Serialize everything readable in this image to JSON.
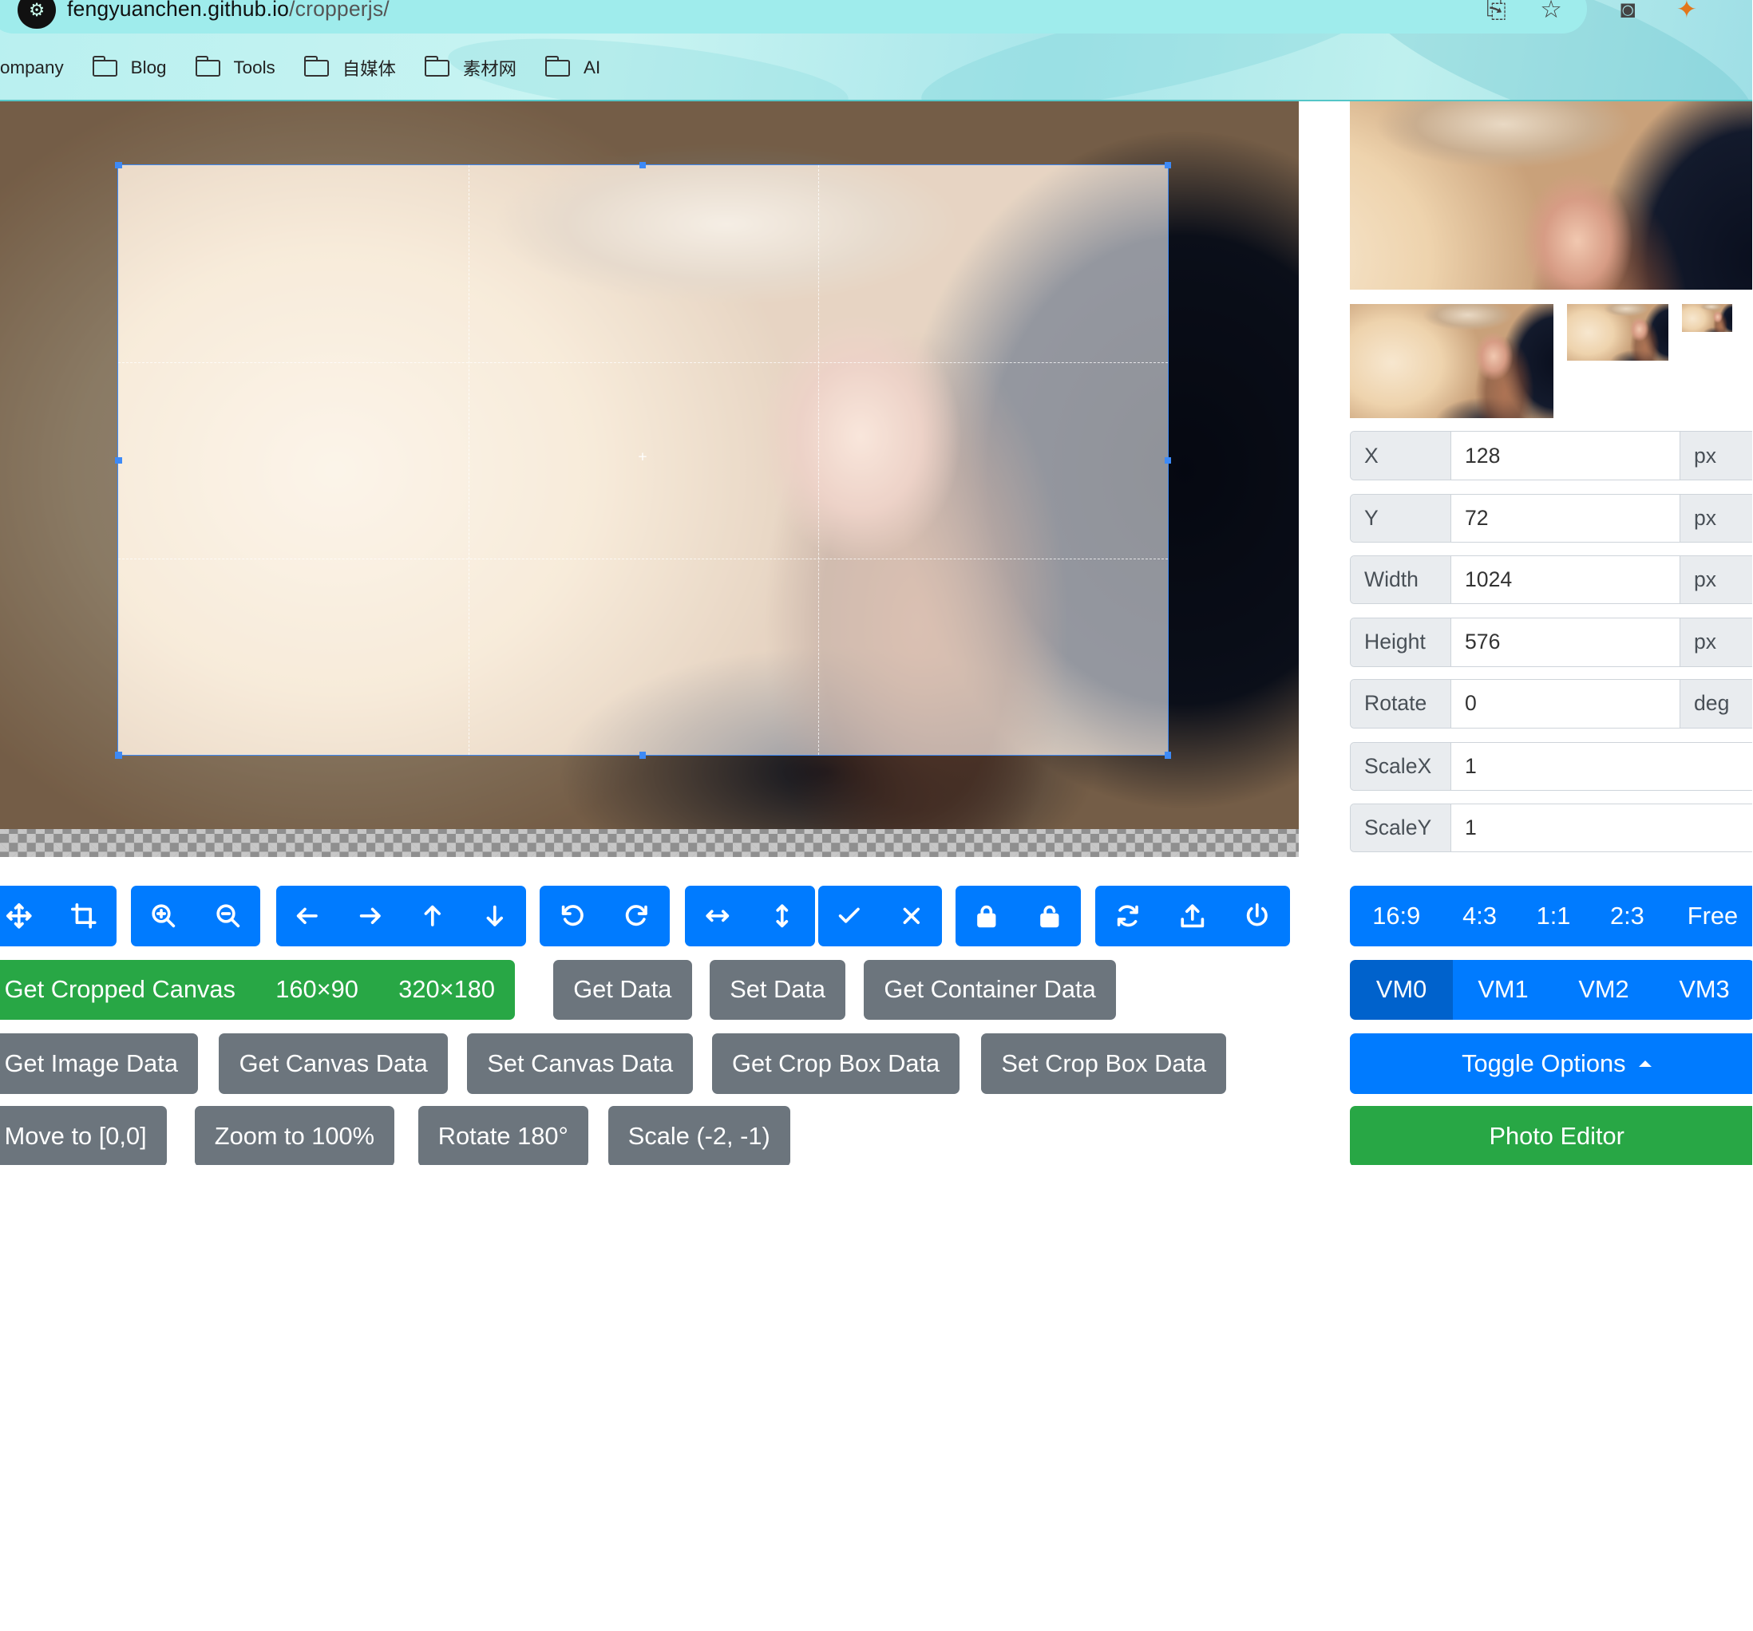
{
  "browser": {
    "url_host": "fengyuanchen.github.io",
    "url_path": "/cropperjs/",
    "bookmarks": [
      "ompany",
      "Blog",
      "Tools",
      "自媒体",
      "素材网",
      "AI"
    ]
  },
  "data_form": [
    {
      "label": "X",
      "value": "128",
      "unit": "px"
    },
    {
      "label": "Y",
      "value": "72",
      "unit": "px"
    },
    {
      "label": "Width",
      "value": "1024",
      "unit": "px"
    },
    {
      "label": "Height",
      "value": "576",
      "unit": "px"
    },
    {
      "label": "Rotate",
      "value": "0",
      "unit": "deg"
    },
    {
      "label": "ScaleX",
      "value": "1",
      "unit": ""
    },
    {
      "label": "ScaleY",
      "value": "1",
      "unit": ""
    }
  ],
  "toolbar_icons": [
    [
      "move-icon",
      "crop-icon"
    ],
    [
      "zoom-in-icon",
      "zoom-out-icon"
    ],
    [
      "arrow-left-icon",
      "arrow-right-icon",
      "arrow-up-icon",
      "arrow-down-icon"
    ],
    [
      "rotate-left-icon",
      "rotate-right-icon"
    ],
    [
      "flip-horizontal-icon",
      "flip-vertical-icon"
    ],
    [
      "check-icon",
      "close-icon"
    ],
    [
      "lock-icon",
      "unlock-icon"
    ],
    [
      "refresh-icon",
      "upload-icon",
      "power-icon"
    ]
  ],
  "buttons": {
    "get_cropped_canvas": "Get Cropped Canvas",
    "size_160": "160×90",
    "size_320": "320×180",
    "get_data": "Get Data",
    "set_data": "Set Data",
    "get_container_data": "Get Container Data",
    "get_image_data": "Get Image Data",
    "get_canvas_data": "Get Canvas Data",
    "set_canvas_data": "Set Canvas Data",
    "get_crop_box_data": "Get Crop Box Data",
    "set_crop_box_data": "Set Crop Box Data",
    "move_to": "Move to [0,0]",
    "zoom_to": "Zoom to 100%",
    "rotate_180": "Rotate 180°",
    "scale": "Scale (-2, -1)"
  },
  "aspect_ratios": [
    "16:9",
    "4:3",
    "1:1",
    "2:3",
    "Free"
  ],
  "view_modes": {
    "items": [
      "VM0",
      "VM1",
      "VM2",
      "VM3"
    ],
    "active": "VM0"
  },
  "toggle_options": "Toggle Options",
  "photo_editor": "Photo Editor",
  "colors": {
    "primary": "#007bff",
    "primary_active": "#0062cc",
    "success": "#28a745",
    "secondary": "#6c757d",
    "crop_outline": "#3d8af7"
  }
}
